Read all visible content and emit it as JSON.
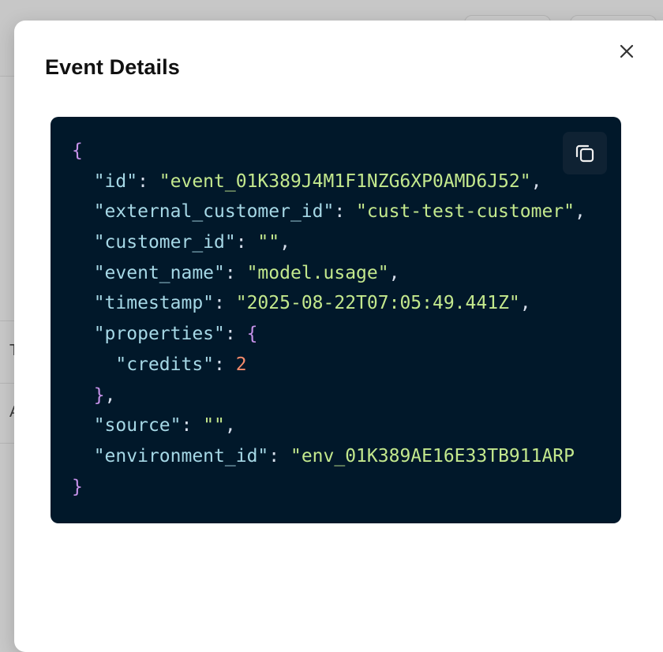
{
  "modal": {
    "title": "Event Details"
  },
  "background": {
    "row1_text": "T",
    "row2_text": "A"
  },
  "colors": {
    "code_background": "#01182a",
    "brace": "#c792ea",
    "key": "#a6d8e6",
    "string": "#c3e88d",
    "number": "#f78c6c"
  },
  "icons": {
    "close": "close-icon",
    "copy": "copy-icon"
  },
  "event_json": {
    "open_brace": "{",
    "close_brace": "}",
    "id_key": "\"id\"",
    "id_value": "\"event_01K389J4M1F1NZG6XP0AMD6J52\"",
    "external_customer_id_key": "\"external_customer_id\"",
    "external_customer_id_value": "\"cust-test-customer\"",
    "customer_id_key": "\"customer_id\"",
    "customer_id_value": "\"\"",
    "event_name_key": "\"event_name\"",
    "event_name_value": "\"model.usage\"",
    "timestamp_key": "\"timestamp\"",
    "timestamp_value": "\"2025-08-22T07:05:49.441Z\"",
    "properties_key": "\"properties\"",
    "properties_open": "{",
    "credits_key": "\"credits\"",
    "credits_value": "2",
    "properties_close": "}",
    "source_key": "\"source\"",
    "source_value": "\"\"",
    "environment_id_key": "\"environment_id\"",
    "environment_id_value": "\"env_01K389AE16E33TB911ARP"
  }
}
